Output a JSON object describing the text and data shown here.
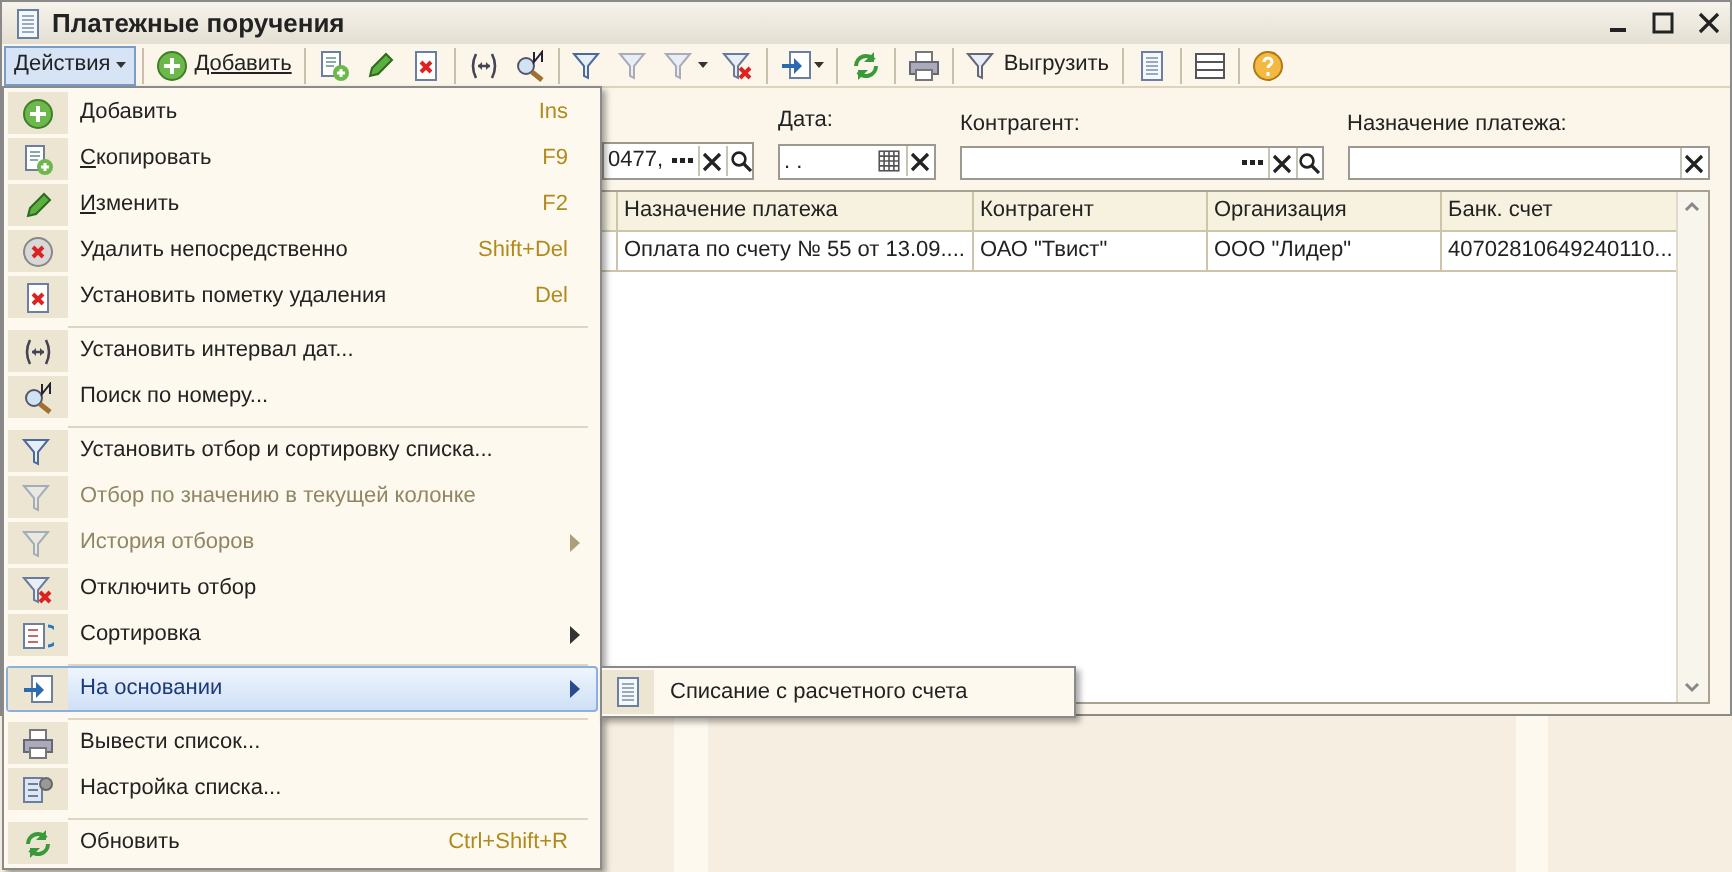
{
  "window": {
    "title": "Платежные поручения"
  },
  "toolbar": {
    "actions": {
      "label": "Действия",
      "open": true
    },
    "add": {
      "label": "Добавить"
    },
    "export": {
      "label": "Выгрузить"
    }
  },
  "filters": [
    {
      "value": "0477,",
      "kind": "ref"
    },
    {
      "label": "Дата:",
      "value": ". .",
      "kind": "date"
    },
    {
      "label": "Контрагент:",
      "kind": "ref"
    },
    {
      "label": "Назначение платежа:",
      "kind": "text"
    }
  ],
  "table": {
    "columns": [
      "Назначение платежа",
      "Контрагент",
      "Организация",
      "Банк. счет"
    ],
    "rows": [
      [
        "Оплата по счету № 55 от 13.09....",
        "ОАО \"Твист\"",
        "ООО \"Лидер\"",
        "40702810649240110..."
      ]
    ]
  },
  "menu": [
    {
      "kind": "item",
      "label": "Добавить",
      "shortcut": "Ins",
      "underline_first": true,
      "disabled": false,
      "submenu": false,
      "selected": false
    },
    {
      "kind": "item",
      "label": "Скопировать",
      "shortcut": "F9",
      "underline_first": true,
      "disabled": false,
      "submenu": false,
      "selected": false
    },
    {
      "kind": "item",
      "label": "Изменить",
      "shortcut": "F2",
      "underline_first": true,
      "disabled": false,
      "submenu": false,
      "selected": false
    },
    {
      "kind": "item",
      "label": "Удалить непосредственно",
      "shortcut": "Shift+Del",
      "underline_first": false,
      "disabled": false,
      "submenu": false,
      "selected": false
    },
    {
      "kind": "item",
      "label": "Установить пометку удаления",
      "shortcut": "Del",
      "underline_first": false,
      "disabled": false,
      "submenu": false,
      "selected": false
    },
    {
      "kind": "separator"
    },
    {
      "kind": "item",
      "label": "Установить интервал дат...",
      "underline_first": false,
      "disabled": false,
      "submenu": false,
      "selected": false
    },
    {
      "kind": "item",
      "label": "Поиск по номеру...",
      "underline_first": false,
      "disabled": false,
      "submenu": false,
      "selected": false
    },
    {
      "kind": "separator"
    },
    {
      "kind": "item",
      "label": "Установить отбор и сортировку списка...",
      "underline_first": false,
      "disabled": false,
      "submenu": false,
      "selected": false
    },
    {
      "kind": "item",
      "label": "Отбор по значению в текущей колонке",
      "underline_first": false,
      "disabled": true,
      "submenu": false,
      "selected": false
    },
    {
      "kind": "item",
      "label": "История отборов",
      "underline_first": false,
      "disabled": true,
      "submenu": true,
      "selected": false
    },
    {
      "kind": "item",
      "label": "Отключить отбор",
      "underline_first": false,
      "disabled": false,
      "submenu": false,
      "selected": false
    },
    {
      "kind": "item",
      "label": "Сортировка",
      "underline_first": false,
      "disabled": false,
      "submenu": true,
      "selected": false
    },
    {
      "kind": "separator"
    },
    {
      "kind": "item",
      "label": "На основании",
      "underline_first": false,
      "disabled": false,
      "submenu": true,
      "selected": true
    },
    {
      "kind": "separator"
    },
    {
      "kind": "item",
      "label": "Вывести список...",
      "underline_first": false,
      "disabled": false,
      "submenu": false,
      "selected": false
    },
    {
      "kind": "item",
      "label": "Настройка списка...",
      "underline_first": false,
      "disabled": false,
      "submenu": false,
      "selected": false
    },
    {
      "kind": "separator"
    },
    {
      "kind": "item",
      "label": "Обновить",
      "shortcut": "Ctrl+Shift+R",
      "underline_first": false,
      "disabled": false,
      "submenu": false,
      "selected": false
    }
  ],
  "submenu": [
    {
      "label": "Списание с расчетного счета"
    }
  ]
}
